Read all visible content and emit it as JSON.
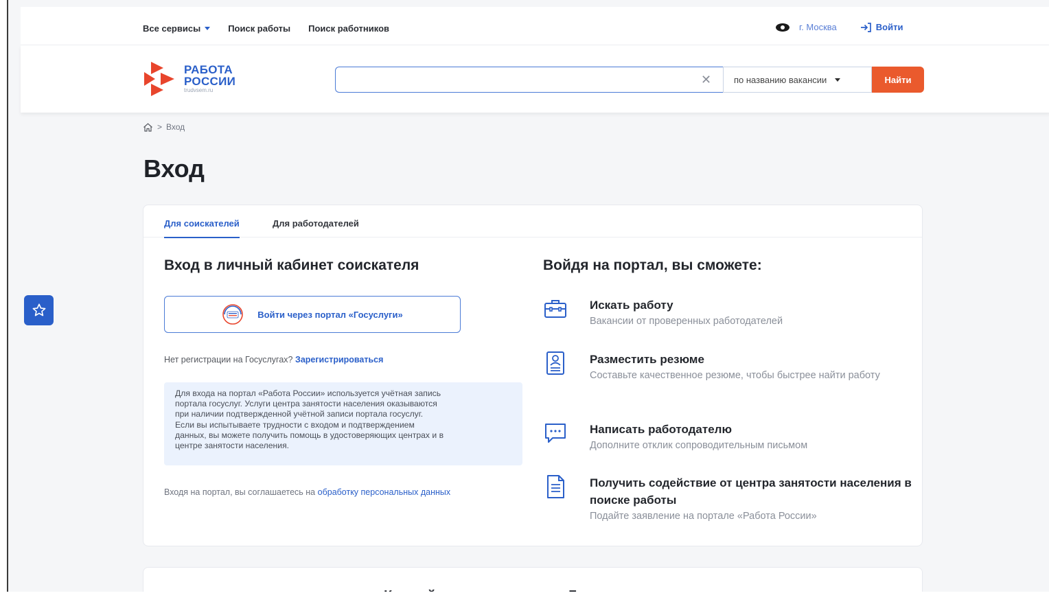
{
  "topnav": {
    "all_services": "Все сервисы",
    "job_search": "Поиск работы",
    "worker_search": "Поиск работников",
    "city": "г. Москва",
    "login": "Войти"
  },
  "logo": {
    "line1": "РАБОТА",
    "line2": "РОССИИ",
    "domain": "trudvsem.ru"
  },
  "search": {
    "value": "",
    "placeholder": "",
    "type_selected": "по названию вакансии",
    "submit": "Найти"
  },
  "breadcrumb": {
    "current": "Вход"
  },
  "page": {
    "title": "Вход"
  },
  "tabs": [
    {
      "label": "Для соискателей",
      "active": true
    },
    {
      "label": "Для работодателей",
      "active": false
    }
  ],
  "login_panel": {
    "heading": "Вход в личный кабинет соискателя",
    "gosuslugi_button": "Войти через портал «Госуслуги»",
    "gosuslugi_logo_text": "гос услуги",
    "no_registration": "Нет регистрации на Госуслугах?",
    "register_link": "Зарегистрироваться",
    "info_lines": [
      "Для входа на портал «Работа России» используется учётная запись",
      "портала госуслуг. Услуги центра занятости населения оказываются",
      "при наличии подтвержденной учётной записи портала госуслуг.",
      "Если вы испытываете трудности с входом и подтверждением",
      "данных, вы можете получить помощь в удостоверяющих центрах и в",
      "центре занятости населения."
    ],
    "agree_text": "Входя на портал, вы соглашаетесь на",
    "agree_link": "обработку персональных данных"
  },
  "features": {
    "heading": "Войдя на портал, вы сможете:",
    "items": [
      {
        "icon": "briefcase-icon",
        "title": "Искать работу",
        "subtitle": "Вакансии от проверенных работодателей"
      },
      {
        "icon": "resume-icon",
        "title": "Разместить резюме",
        "subtitle": "Составьте качественное резюме, чтобы быстрее найти работу"
      },
      {
        "icon": "chat-icon",
        "title": "Написать работодателю",
        "subtitle": "Дополните отклик сопроводительным письмом"
      },
      {
        "icon": "document-icon",
        "title": "Получить содействие от центра занятости населения в поиске работы",
        "subtitle": "Подайте заявление на портале «Работа России»"
      }
    ]
  },
  "next_section": {
    "title": "Как войти на портал через Госуслуги"
  },
  "colors": {
    "brand_blue": "#2a5fc9",
    "accent_orange": "#ea5a2d",
    "logo_red": "#e8452c",
    "info_bg": "#ebf2fd"
  }
}
